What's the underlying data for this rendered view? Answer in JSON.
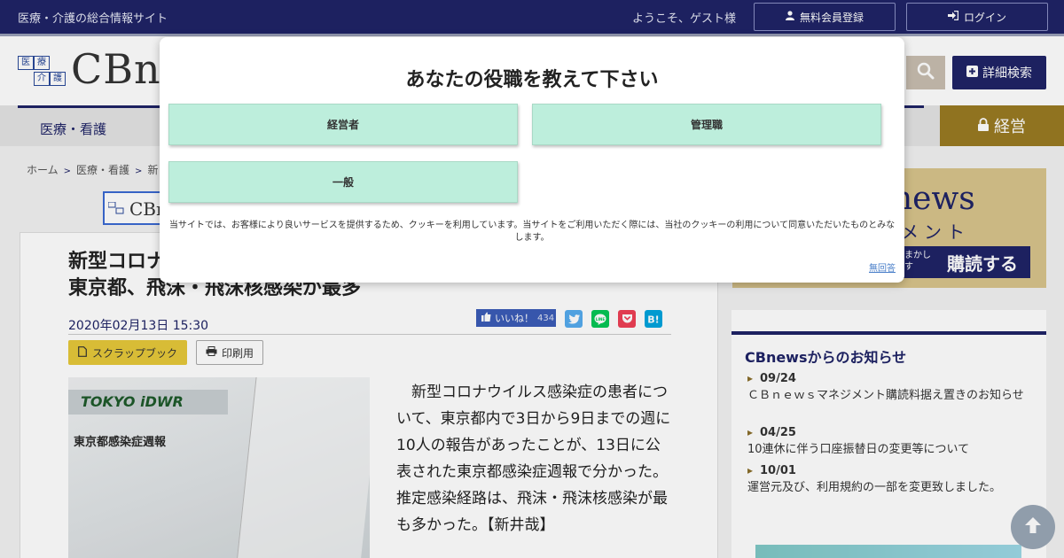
{
  "topbar": {
    "tagline": "医療・介護の総合情報サイト",
    "welcome": "ようこそ、ゲスト様",
    "register_label": "無料会員登録",
    "login_label": "ログイン"
  },
  "header": {
    "logo_cells": [
      "医",
      "療",
      "介",
      "護"
    ],
    "logo_text": "CBne",
    "advanced_search_label": "詳細検索"
  },
  "nav": {
    "item_1": "医療・看護",
    "keiei_label": "経営"
  },
  "breadcrumb": {
    "items": [
      "ホーム",
      "医療・看護",
      "新"
    ]
  },
  "article": {
    "banner_text": "CBn",
    "title_line1": "新型コロナ",
    "title_line2": "東京都、飛沫・飛沫核感染が最多",
    "date": "2020年02月13日 15:30",
    "like_label": "いいね！",
    "like_count": "434",
    "scrapbook_label": "スクラップブック",
    "print_label": "印刷用",
    "photo_brand": "TOKYO iDWR",
    "photo_subtitle": "東京都感染症週報",
    "body": "新型コロナウイルス感染症の患者について、東京都内で3日から9日までの週に10人の報告があったことが、13日に公表された東京都感染症週報で分かった。推定感染経路は、飛沫・飛沫核感染が最も多かった。【新井哉】"
  },
  "ad": {
    "line1": "news",
    "line2": "メント",
    "line3_small_1": "まかし",
    "line3_small_2": "す",
    "line3_big": "購読する"
  },
  "news": {
    "title": "CBnewsからのお知らせ",
    "items": [
      {
        "date": "09/24",
        "text": "ＣＢｎｅｗｓマネジメント購読料据え置きのお知らせ"
      },
      {
        "date": "04/25",
        "text": "10連休に伴う口座振替日の変更等について"
      },
      {
        "date": "10/01",
        "text": "運営元及び、利用規約の一部を変更致しました。"
      }
    ]
  },
  "modal": {
    "question": "あなたの役職を教えて下さい",
    "options": [
      "経営者",
      "管理職",
      "一般"
    ],
    "cookie_notice": "当サイトでは、お客様により良いサービスを提供するため、クッキーを利用しています。当サイトをご利用いただく際には、当社のクッキーの利用について同意いただいたものとみなします。",
    "no_answer_label": "無回答"
  },
  "colors": {
    "navy": "#1f2466",
    "gold": "#9a7b23",
    "option_green": "#bdeedc",
    "scrap_yellow": "#e6c83a"
  }
}
